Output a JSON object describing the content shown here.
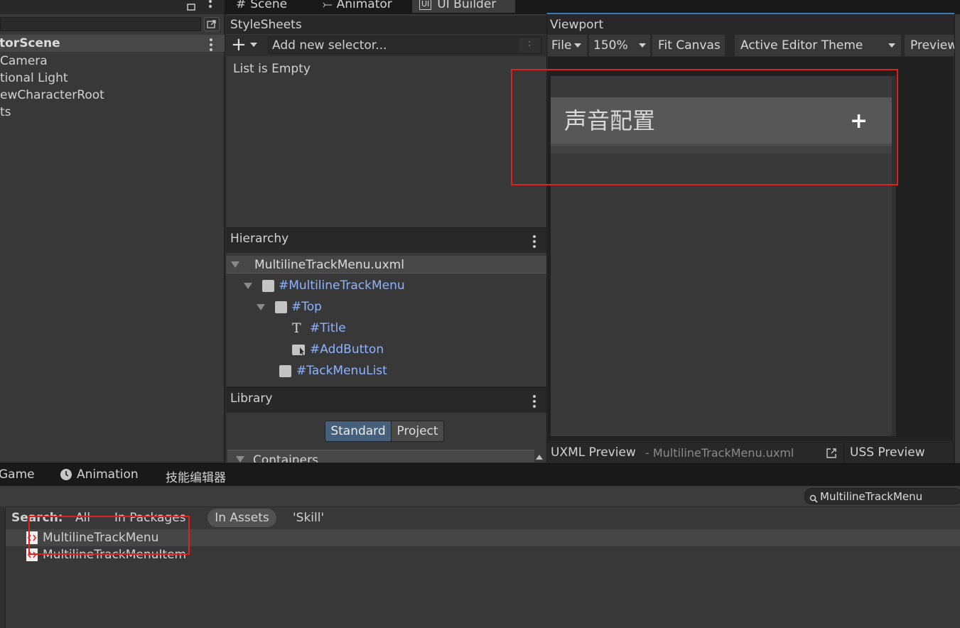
{
  "top_tabs": {
    "scene": "Scene",
    "animator": "Animator",
    "ui_builder": "UI Builder"
  },
  "left_hierarchy": {
    "scene_name": "torScene",
    "items": [
      "Camera",
      "tional Light",
      "ewCharacterRoot",
      "ts"
    ]
  },
  "stylesheets": {
    "title": "StyleSheets",
    "selector_placeholder": "Add new selector...",
    "selector_hint": ":",
    "empty_text": "List is Empty"
  },
  "hierarchy": {
    "title": "Hierarchy",
    "file": "MultilineTrackMenu.uxml",
    "nodes": [
      "#MultilineTrackMenu",
      "#Top",
      "#Title",
      "#AddButton",
      "#TackMenuList"
    ]
  },
  "library": {
    "title": "Library",
    "tab_standard": "Standard",
    "tab_project": "Project",
    "section": "Containers"
  },
  "viewport": {
    "title": "Viewport",
    "file_menu": "File",
    "zoom": "150%",
    "fit_canvas": "Fit Canvas",
    "theme": "Active Editor Theme",
    "preview": "Preview",
    "canvas_title": "声音配置",
    "add_symbol": "+"
  },
  "preview_bar": {
    "uxml_label": "UXML Preview",
    "uxml_file": "- MultilineTrackMenu.uxml",
    "uss_label": "USS Preview"
  },
  "bottom_tabs": {
    "game": "Game",
    "animation": "Animation",
    "skill_editor": "技能编辑器"
  },
  "project": {
    "search_value": "MultilineTrackMenu",
    "search_label": "Search:",
    "filter_all": "All",
    "filter_packages": "In Packages",
    "filter_assets": "In Assets",
    "filter_skill": "'Skill'",
    "results": [
      "MultilineTrackMenu",
      "MultilineTrackMenuItem"
    ]
  },
  "colors": {
    "accent_link": "#8eb3ff",
    "highlight_red": "#e02020",
    "selected_tab": "#46607c"
  }
}
